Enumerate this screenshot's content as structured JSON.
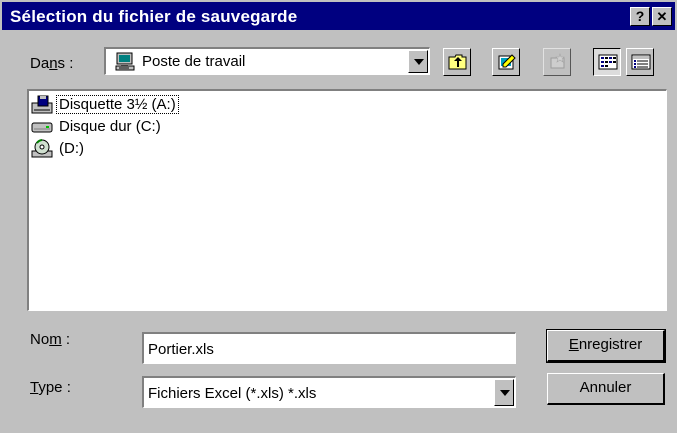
{
  "window": {
    "title": "Sélection du fichier de sauvegarde",
    "help_label": "?",
    "close_label": "✕"
  },
  "look_in": {
    "label_pre": "Da",
    "label_key": "n",
    "label_post": "s :",
    "value": "Poste de travail"
  },
  "toolbar": {
    "icons": [
      "up-one-level-icon",
      "new-folder-icon",
      "desktop-icon",
      "list-view-icon",
      "details-view-icon"
    ]
  },
  "files": [
    {
      "name": "Disquette 3½ (A:)",
      "icon": "floppy-drive-icon"
    },
    {
      "name": "Disque dur (C:)",
      "icon": "hard-drive-icon"
    },
    {
      "name": "(D:)",
      "icon": "cd-drive-icon"
    }
  ],
  "filename": {
    "label_pre": "No",
    "label_key": "m",
    "label_post": " :",
    "value": "Portier.xls"
  },
  "filetype": {
    "label_key": "T",
    "label_post": "ype :",
    "value": "Fichiers Excel (*.xls) *.xls"
  },
  "buttons": {
    "save_key": "E",
    "save_rest": "nregistrer",
    "cancel": "Annuler"
  }
}
